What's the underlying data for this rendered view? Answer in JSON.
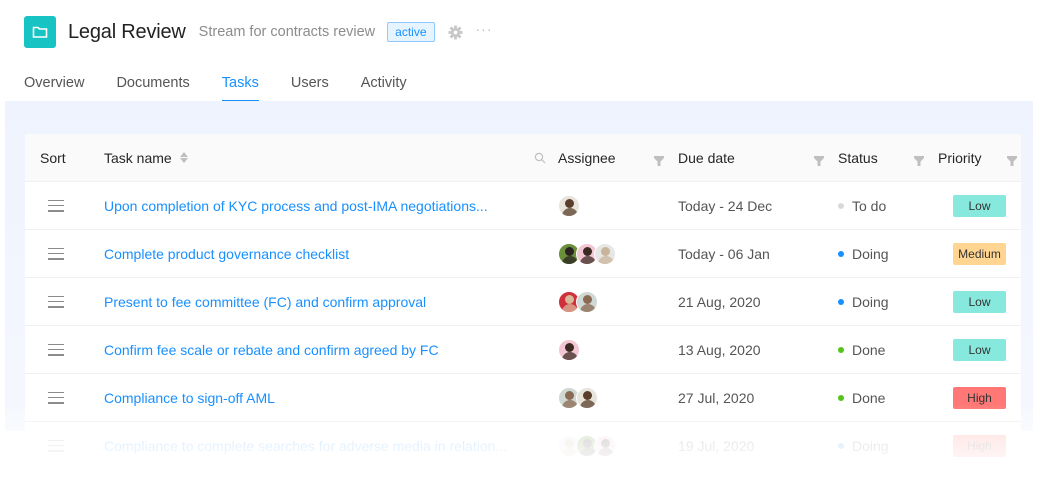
{
  "header": {
    "title": "Legal Review",
    "subtitle": "Stream for contracts review",
    "badge": "active",
    "icons": [
      "folder-icon",
      "gear-icon",
      "more-icon"
    ]
  },
  "tabs": [
    {
      "label": "Overview",
      "active": false
    },
    {
      "label": "Documents",
      "active": false
    },
    {
      "label": "Tasks",
      "active": true
    },
    {
      "label": "Users",
      "active": false
    },
    {
      "label": "Activity",
      "active": false
    }
  ],
  "table": {
    "columns": {
      "sort": "Sort",
      "name": "Task name",
      "assignee": "Assignee",
      "due": "Due date",
      "status": "Status",
      "priority": "Priority"
    },
    "rows": [
      {
        "name": "Upon completion of KYC process and post-IMA negotiations...",
        "assignees": 1,
        "due": "Today - 24 Dec",
        "status": "To do",
        "priority": "Low"
      },
      {
        "name": "Complete product governance checklist",
        "assignees": 3,
        "due": "Today - 06 Jan",
        "status": "Doing",
        "priority": "Medium"
      },
      {
        "name": "Present to fee committee (FC) and confirm approval",
        "assignees": 2,
        "due": "21 Aug, 2020",
        "status": "Doing",
        "priority": "Low"
      },
      {
        "name": "Confirm fee scale or rebate and confirm agreed by FC",
        "assignees": 1,
        "due": "13 Aug, 2020",
        "status": "Done",
        "priority": "Low"
      },
      {
        "name": "Compliance to sign-off AML",
        "assignees": 2,
        "due": "27 Jul, 2020",
        "status": "Done",
        "priority": "High"
      },
      {
        "name": "Compliance to complete searches for adverse media in relation...",
        "assignees": 3,
        "due": "19 Jul, 2020",
        "status": "Doing",
        "priority": "High"
      }
    ]
  },
  "colors": {
    "accent": "#1890ff",
    "brand_tile": "#17c3c3",
    "status": {
      "To do": "#d9d9d9",
      "Doing": "#1890ff",
      "Done": "#52c41a"
    },
    "priority": {
      "Low": "#87e8de",
      "Medium": "#ffd591",
      "High": "#ff7875"
    }
  }
}
